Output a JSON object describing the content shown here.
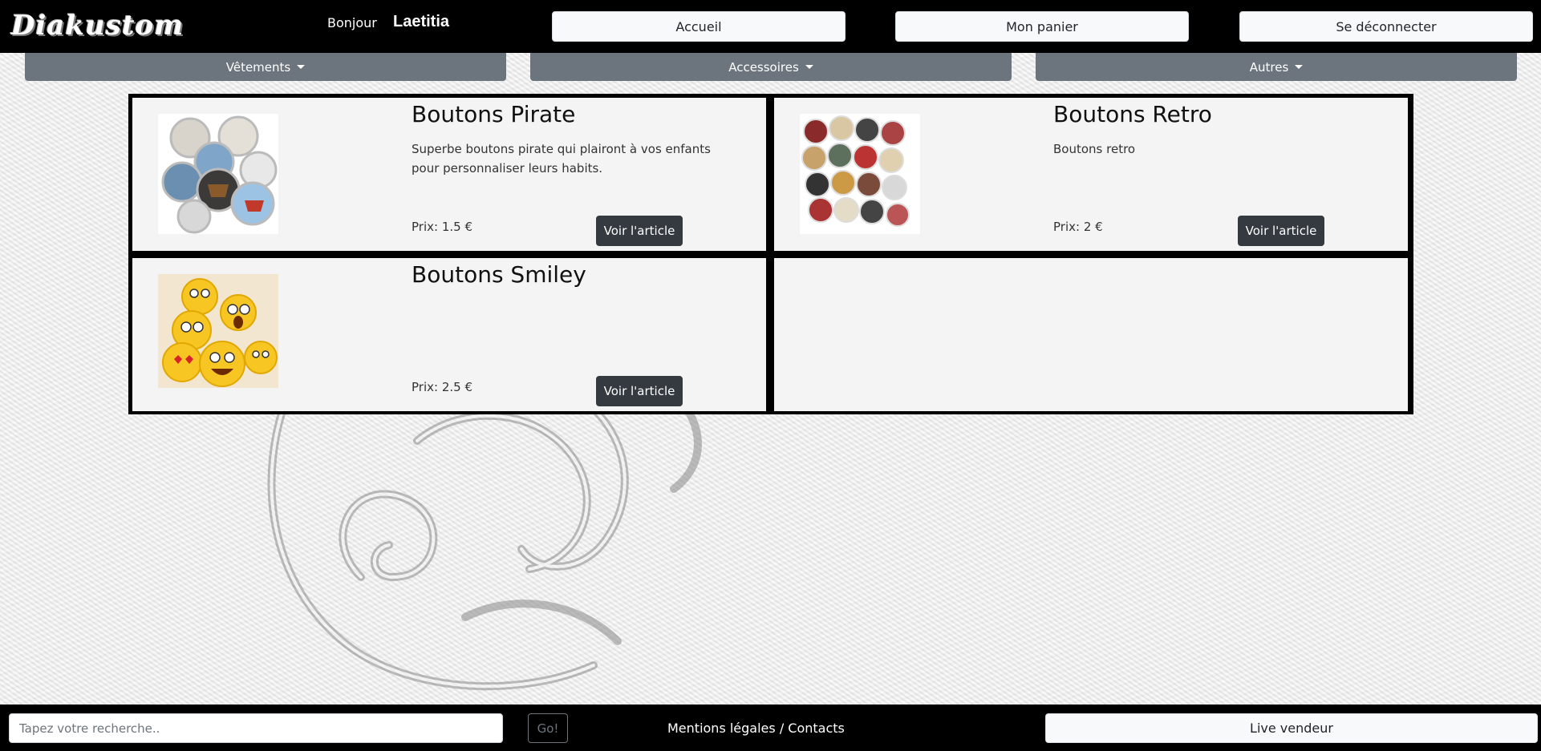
{
  "header": {
    "logo_text": "Diakustom",
    "greeting": "Bonjour",
    "username": "Laetitia",
    "home_label": "Accueil",
    "cart_label": "Mon panier",
    "logout_label": "Se déconnecter"
  },
  "categories": [
    {
      "label": "Vêtements"
    },
    {
      "label": "Accessoires"
    },
    {
      "label": "Autres"
    }
  ],
  "products": [
    {
      "title": "Boutons Pirate",
      "description": "Superbe boutons pirate qui plairont à vos enfants pour personnaliser leurs habits.",
      "price": "Prix: 1.5 €",
      "button": "Voir l'article",
      "image": "pirate-buttons-photo"
    },
    {
      "title": "Boutons Retro",
      "description": "Boutons retro",
      "price": "Prix: 2 €",
      "button": "Voir l'article",
      "image": "retro-buttons-photo"
    },
    {
      "title": "Boutons Smiley",
      "description": "",
      "price": "Prix: 2.5 €",
      "button": "Voir l'article",
      "image": "smiley-buttons-photo"
    }
  ],
  "footer": {
    "search_placeholder": "Tapez votre recherche..",
    "go_label": "Go!",
    "legal_label": "Mentions légales / Contacts",
    "live_label": "Live vendeur"
  },
  "colors": {
    "nav_bg": "#000000",
    "category_bg": "#6c757d",
    "button_dark": "#343a40",
    "card_bg": "#f4f4f4"
  }
}
